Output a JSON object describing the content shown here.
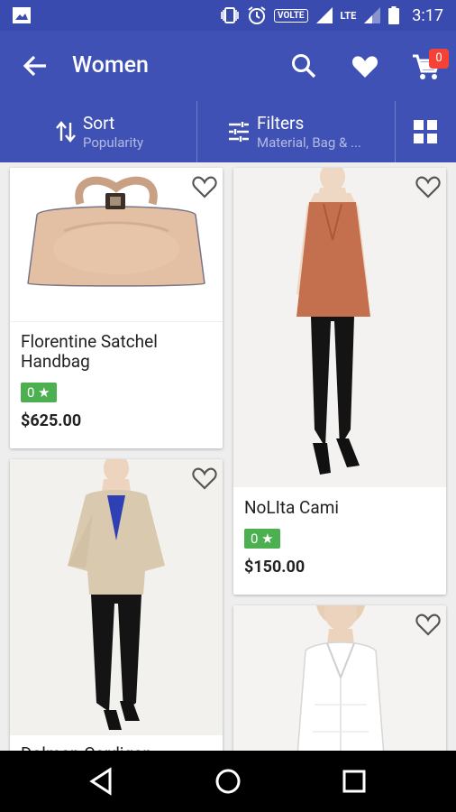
{
  "status_bar": {
    "network": "VOLTE",
    "signal_type": "LTE",
    "time": "3:17"
  },
  "app_bar": {
    "title": "Women",
    "cart_count": "0"
  },
  "filter_bar": {
    "sort_label": "Sort",
    "sort_value": "Popularity",
    "filter_label": "Filters",
    "filter_value": "Material, Bag & ..."
  },
  "products": [
    {
      "name": "Florentine Satchel Handbag",
      "rating": "0 ★",
      "price": "$625.00"
    },
    {
      "name": "NoLIta Cami",
      "rating": "0 ★",
      "price": "$150.00"
    },
    {
      "name": "Dolman Cardigan"
    },
    {
      "name": ""
    }
  ],
  "colors": {
    "primary": "#3f51b5",
    "primary_dark": "#3a4bb0",
    "rating_green": "#4caf50",
    "badge_red": "#f44336"
  },
  "icons": {
    "status_left": "gallery-icon",
    "back": "arrow-back-icon",
    "search": "search-icon",
    "wishlist": "heart-icon",
    "cart": "cart-icon",
    "sort": "sort-arrows-icon",
    "filter": "tune-icon",
    "view": "grid-view-icon"
  }
}
